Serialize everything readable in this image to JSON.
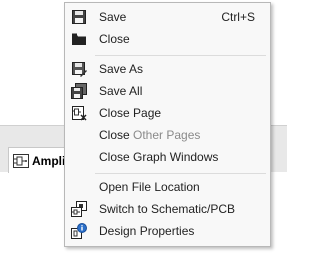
{
  "document_tab": {
    "label": "Amplif"
  },
  "menu": {
    "save": {
      "label": "Save",
      "shortcut": "Ctrl+S"
    },
    "close": {
      "label": "Close"
    },
    "save_as": {
      "label": "Save As"
    },
    "save_all": {
      "label": "Save All"
    },
    "close_page": {
      "label": "Close Page"
    },
    "close_other_pages": {
      "label_prefix": "Close ",
      "label_dim": "Other Pages"
    },
    "close_graph_windows": {
      "label": "Close Graph Windows"
    },
    "open_file_location": {
      "label": "Open File Location"
    },
    "switch_to_schematic_pcb": {
      "label": "Switch to Schematic/PCB"
    },
    "design_properties": {
      "label": "Design Properties"
    }
  }
}
